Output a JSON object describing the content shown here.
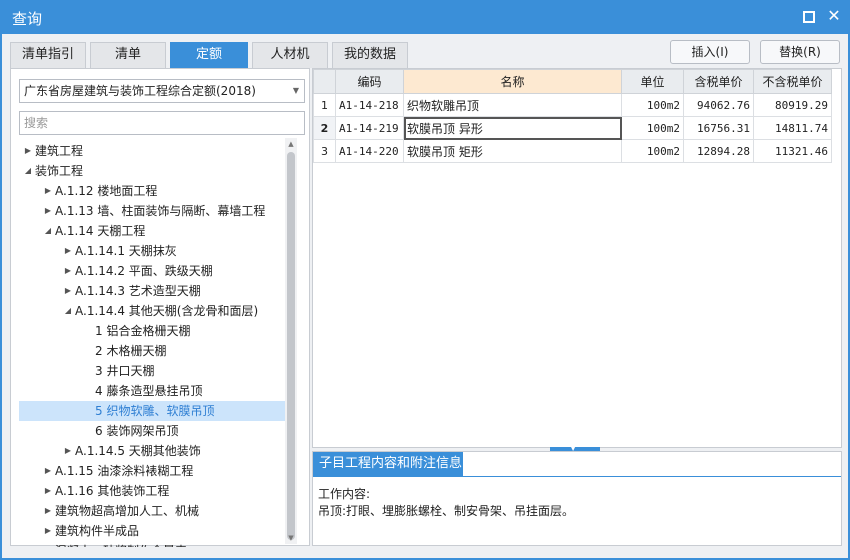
{
  "window": {
    "title": "查询"
  },
  "tabs": [
    "清单指引",
    "清单",
    "定额",
    "人材机",
    "我的数据"
  ],
  "buttons": {
    "insert": "插入(I)",
    "replace": "替换(R)"
  },
  "library": {
    "selected": "广东省房屋建筑与装饰工程综合定额(2018)"
  },
  "search": {
    "placeholder": "搜索"
  },
  "tree": [
    {
      "label": "建筑工程",
      "level": 0,
      "arrow": "right"
    },
    {
      "label": "装饰工程",
      "level": 0,
      "arrow": "down"
    },
    {
      "label": "A.1.12 楼地面工程",
      "level": 1,
      "arrow": "right"
    },
    {
      "label": "A.1.13 墙、柱面装饰与隔断、幕墙工程",
      "level": 1,
      "arrow": "right"
    },
    {
      "label": "A.1.14 天棚工程",
      "level": 1,
      "arrow": "down"
    },
    {
      "label": "A.1.14.1 天棚抹灰",
      "level": 2,
      "arrow": "right"
    },
    {
      "label": "A.1.14.2 平面、跌级天棚",
      "level": 2,
      "arrow": "right"
    },
    {
      "label": "A.1.14.3 艺术造型天棚",
      "level": 2,
      "arrow": "right"
    },
    {
      "label": "A.1.14.4 其他天棚(含龙骨和面层)",
      "level": 2,
      "arrow": "down"
    },
    {
      "label": "1 铝合金格栅天棚",
      "level": 3,
      "arrow": ""
    },
    {
      "label": "2 木格栅天棚",
      "level": 3,
      "arrow": ""
    },
    {
      "label": "3 井口天棚",
      "level": 3,
      "arrow": ""
    },
    {
      "label": "4 藤条造型悬挂吊顶",
      "level": 3,
      "arrow": ""
    },
    {
      "label": "5 织物软雕、软膜吊顶",
      "level": 3,
      "arrow": "",
      "selected": true
    },
    {
      "label": "6 装饰网架吊顶",
      "level": 3,
      "arrow": ""
    },
    {
      "label": "A.1.14.5 天棚其他装饰",
      "level": 2,
      "arrow": "right"
    },
    {
      "label": "A.1.15 油漆涂料裱糊工程",
      "level": 1,
      "arrow": "right"
    },
    {
      "label": "A.1.16 其他装饰工程",
      "level": 1,
      "arrow": "right"
    },
    {
      "label": "建筑物超高增加人工、机械",
      "level": 1,
      "arrow": "right"
    },
    {
      "label": "建筑构件半成品",
      "level": 1,
      "arrow": "right"
    },
    {
      "label": "混凝土、砂浆制作含量表",
      "level": 1,
      "arrow": "right"
    }
  ],
  "grid": {
    "headers": [
      "编码",
      "名称",
      "单位",
      "含税单价",
      "不含税单价"
    ],
    "rows": [
      {
        "idx": "1",
        "code": "A1-14-218",
        "name": "织物软雕吊顶",
        "unit": "100m2",
        "price_tax": "94062.76",
        "price_notax": "80919.29"
      },
      {
        "idx": "2",
        "code": "A1-14-219",
        "name": "软膜吊顶 异形",
        "unit": "100m2",
        "price_tax": "16756.31",
        "price_notax": "14811.74"
      },
      {
        "idx": "3",
        "code": "A1-14-220",
        "name": "软膜吊顶 矩形",
        "unit": "100m2",
        "price_tax": "12894.28",
        "price_notax": "11321.46"
      }
    ]
  },
  "info": {
    "tab": "子目工程内容和附注信息",
    "line1": "工作内容:",
    "line2": "吊顶:打眼、埋膨胀螺栓、制安骨架、吊挂面层。"
  }
}
